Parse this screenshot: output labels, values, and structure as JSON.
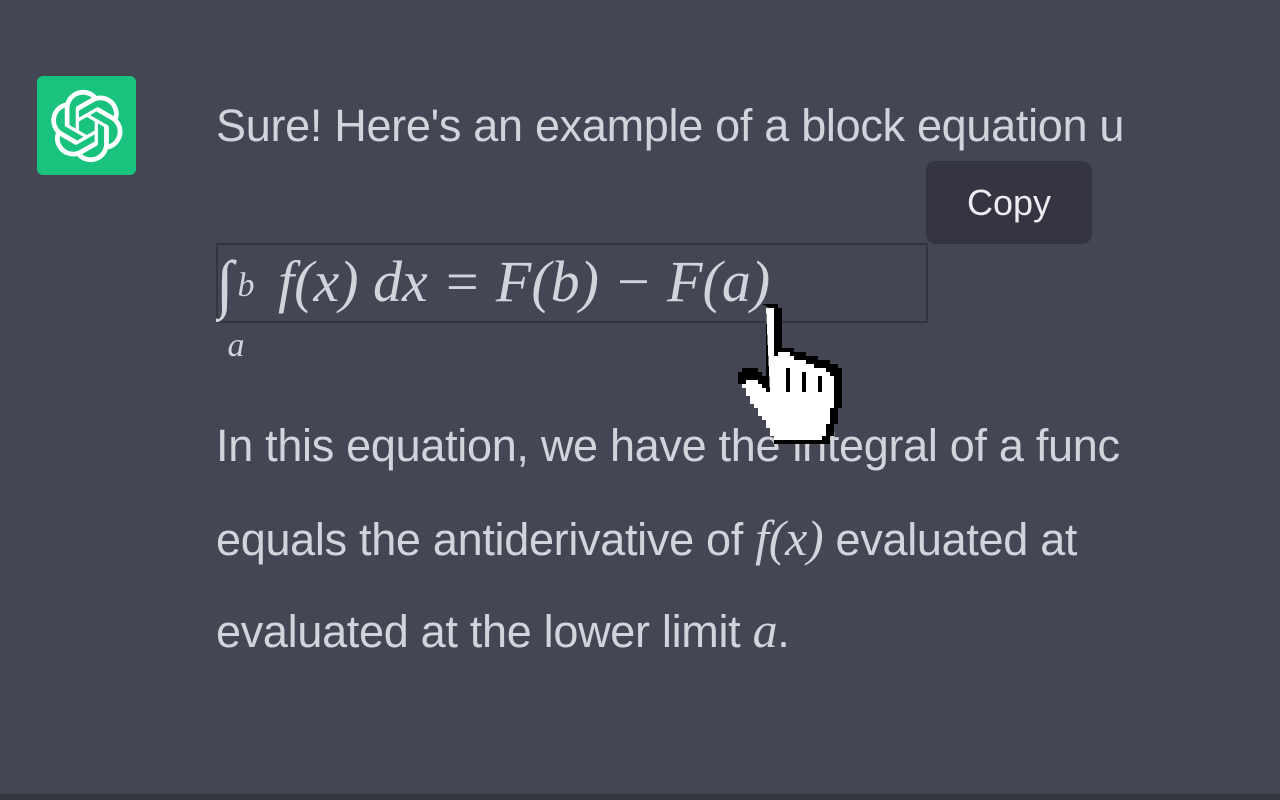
{
  "message": {
    "line1": "Sure! Here's an example of a block equation u",
    "line2_a": "In this equation, we have the integral of a func",
    "line3_a": "equals the antiderivative of ",
    "line3_math": "f(x)",
    "line3_b": " evaluated at",
    "line4_a": "evaluated at the lower limit ",
    "line4_math": "a",
    "line4_b": "."
  },
  "equation": {
    "upper_limit": "b",
    "lower_limit": "a",
    "body": "f(x) dx = F(b) − F(a)"
  },
  "tooltip": {
    "label": "Copy"
  },
  "icons": {
    "avatar": "openai-logo-icon",
    "cursor": "hand-pointer-cursor"
  },
  "colors": {
    "background": "#444654",
    "avatar_bg": "#19c37d",
    "text": "#d1d5db",
    "tooltip_bg": "#343541"
  }
}
